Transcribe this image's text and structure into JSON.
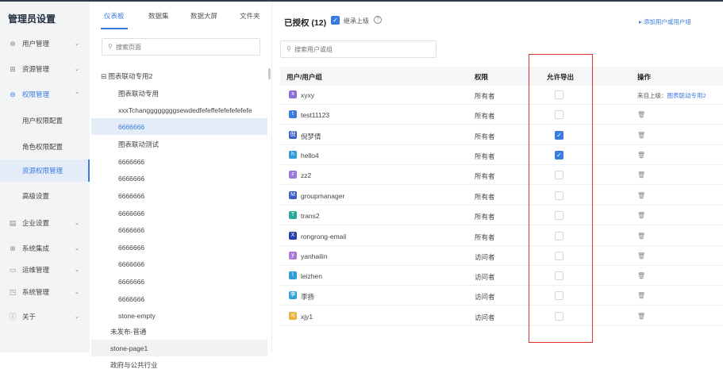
{
  "nav": {
    "title": "管理员设置",
    "items": [
      {
        "label": "用户管理",
        "icon": "user-icon",
        "glyph": "⊛",
        "chev": "⌄"
      },
      {
        "label": "资源管理",
        "icon": "grid-icon",
        "glyph": "⊞",
        "chev": "⌄"
      },
      {
        "label": "权限管理",
        "icon": "shield-icon",
        "glyph": "⊜",
        "chev": "⌃"
      },
      {
        "label": "用户权限配置"
      },
      {
        "label": "角色权限配置"
      },
      {
        "label": "资源权限管理"
      },
      {
        "label": "高级设置"
      },
      {
        "label": "企业设置",
        "icon": "building-icon",
        "glyph": "▤",
        "chev": "⌄"
      },
      {
        "label": "系统集成",
        "icon": "link-icon",
        "glyph": "⊗",
        "chev": "⌄"
      },
      {
        "label": "运维管理",
        "icon": "monitor-icon",
        "glyph": "▭",
        "chev": "⌄"
      },
      {
        "label": "系统管理",
        "icon": "settings-icon",
        "glyph": "◳",
        "chev": "⌄"
      },
      {
        "label": "关于",
        "icon": "info-icon",
        "glyph": "ⓘ",
        "chev": "⌄"
      }
    ]
  },
  "tree": {
    "tabs": [
      "仪表板",
      "数据集",
      "数据大屏",
      "文件夹"
    ],
    "search_placeholder": "搜索页面",
    "rows": [
      {
        "label": "⊟ 图表联动专用2"
      },
      {
        "label": "图表联动专用"
      },
      {
        "label": "xxxTchanggggggggsewdedfefeffefefefefefefe"
      },
      {
        "label": "6666666"
      },
      {
        "label": "图表联动测试"
      },
      {
        "label": "6666666"
      },
      {
        "label": "6666666"
      },
      {
        "label": "6666666"
      },
      {
        "label": "6666666"
      },
      {
        "label": "6666666"
      },
      {
        "label": "6666666"
      },
      {
        "label": "6666666"
      },
      {
        "label": "6666666"
      },
      {
        "label": "6666666"
      },
      {
        "label": "stone-empty"
      },
      {
        "label": "未发布-普通"
      },
      {
        "label": "stone-page1"
      },
      {
        "label": "政府与公共行业"
      }
    ]
  },
  "main": {
    "title": "已授权 (12)",
    "inherit_label": "继承上级",
    "help": "?",
    "add_link": "▸ 添加用户或用户组",
    "search_placeholder": "搜索用户或组",
    "headers": {
      "user": "用户/用户组",
      "role": "权限",
      "export": "允许导出",
      "ops": "操作"
    },
    "rows": [
      {
        "name": "xyxy",
        "role": "所有者",
        "export": false,
        "ops_prefix": "来自上级：",
        "ops_link": "图表联动专用2",
        "color": "#8e6fd8",
        "glyph": "x"
      },
      {
        "name": "test11123",
        "role": "所有者",
        "export": false,
        "color": "#3a7be0",
        "glyph": "t"
      },
      {
        "name": "倪梦倩",
        "role": "所有者",
        "export": true,
        "color": "#3a5fc8",
        "glyph": "倪"
      },
      {
        "name": "hello4",
        "role": "所有者",
        "export": true,
        "color": "#2f9bd6",
        "glyph": "h"
      },
      {
        "name": "zz2",
        "role": "所有者",
        "export": false,
        "color": "#9a7ad8",
        "glyph": "z"
      },
      {
        "name": "groupmanager",
        "role": "所有者",
        "export": false,
        "color": "#3a5fc8",
        "glyph": "M"
      },
      {
        "name": "trans2",
        "role": "所有者",
        "export": false,
        "color": "#2aa79b",
        "glyph": "T"
      },
      {
        "name": "rongrong-email",
        "role": "所有者",
        "export": false,
        "color": "#2b3fa8",
        "glyph": "X"
      },
      {
        "name": "yanhailin",
        "role": "访问者",
        "export": false,
        "color": "#a97ad8",
        "glyph": "y"
      },
      {
        "name": "leizhen",
        "role": "访问者",
        "export": false,
        "color": "#2f9bd6",
        "glyph": "l"
      },
      {
        "name": "李扬",
        "role": "访问者",
        "export": false,
        "color": "#2fa3d6",
        "glyph": "李"
      },
      {
        "name": "xjy1",
        "role": "访问者",
        "export": false,
        "color": "#e8b33a",
        "glyph": "xj"
      }
    ],
    "trash_glyph": "🗑",
    "check_glyph": "✓"
  }
}
